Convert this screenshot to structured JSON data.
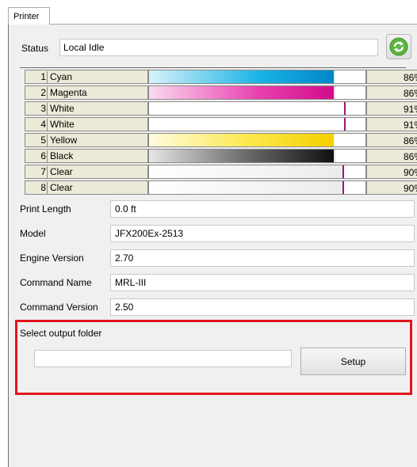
{
  "tab": {
    "label": "Printer"
  },
  "status": {
    "label": "Status",
    "value": "Local Idle"
  },
  "inks": [
    {
      "num": "1",
      "name": "Cyan",
      "percent": "86%",
      "level": 0.86,
      "color": "cyan"
    },
    {
      "num": "2",
      "name": "Magenta",
      "percent": "86%",
      "level": 0.86,
      "color": "magenta"
    },
    {
      "num": "3",
      "name": "White",
      "percent": "91%",
      "level": 0.91,
      "color": "white"
    },
    {
      "num": "4",
      "name": "White",
      "percent": "91%",
      "level": 0.91,
      "color": "white"
    },
    {
      "num": "5",
      "name": "Yellow",
      "percent": "86%",
      "level": 0.86,
      "color": "yellow"
    },
    {
      "num": "6",
      "name": "Black",
      "percent": "86%",
      "level": 0.86,
      "color": "black"
    },
    {
      "num": "7",
      "name": "Clear",
      "percent": "90%",
      "level": 0.9,
      "color": "clear"
    },
    {
      "num": "8",
      "name": "Clear",
      "percent": "90%",
      "level": 0.9,
      "color": "clear"
    }
  ],
  "info": [
    {
      "label": "Print Length",
      "value": "0.0 ft"
    },
    {
      "label": "Model",
      "value": "JFX200Ex-2513"
    },
    {
      "label": "Engine Version",
      "value": "2.70"
    },
    {
      "label": "Command Name",
      "value": "MRL-III"
    },
    {
      "label": "Command Version",
      "value": "2.50"
    }
  ],
  "output": {
    "title": "Select output folder",
    "folder": "",
    "setup_label": "Setup"
  },
  "colors": {
    "highlight": "#e0151c",
    "refresh": "#5db443"
  },
  "icons": {
    "refresh": "refresh-icon"
  }
}
